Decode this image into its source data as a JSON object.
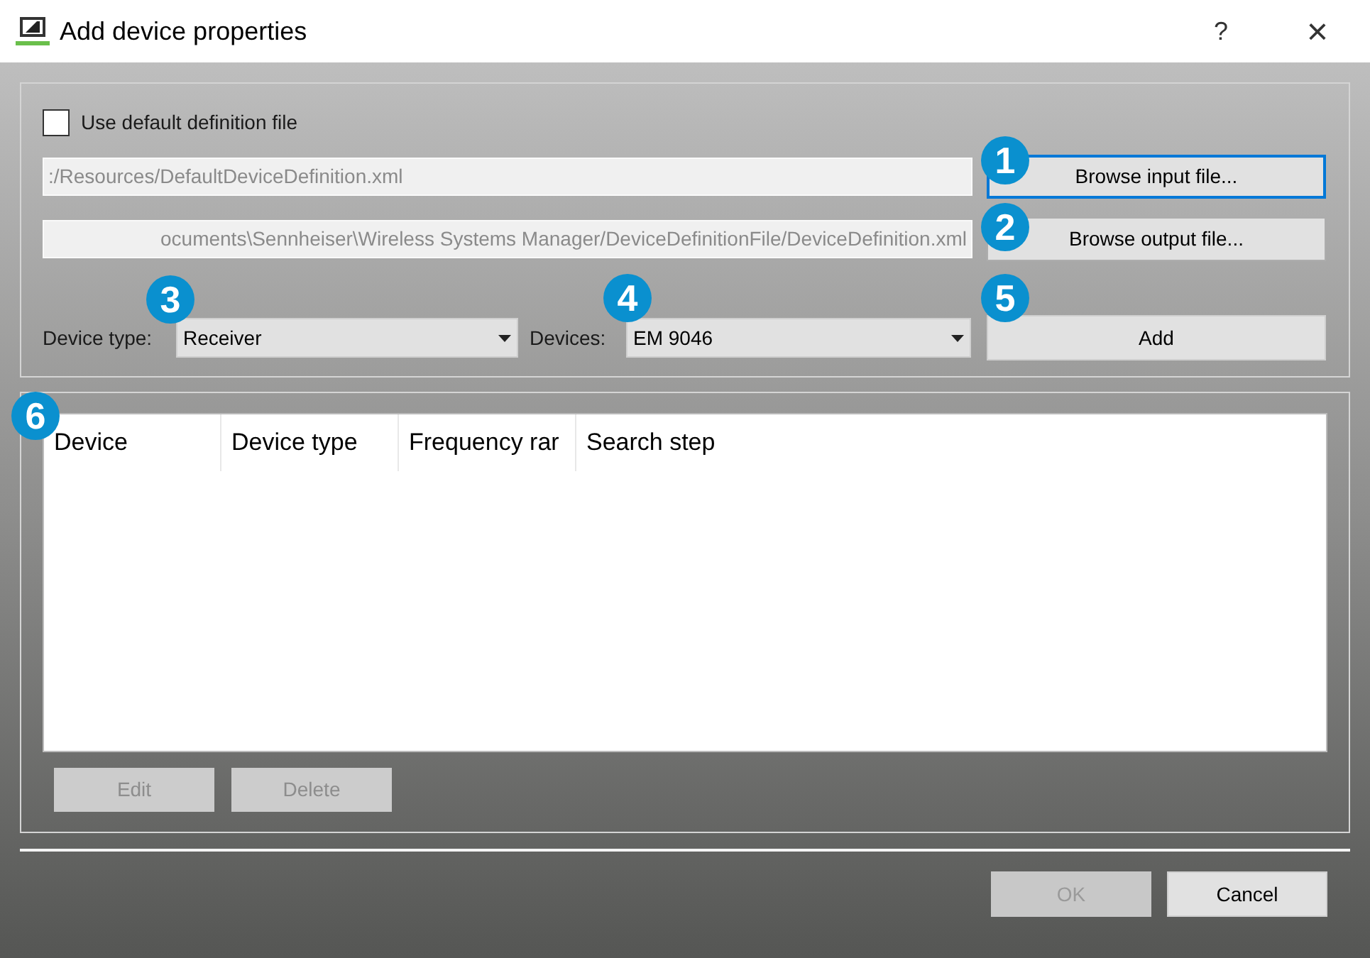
{
  "window": {
    "title": "Add device properties",
    "help": "?",
    "close": "×"
  },
  "use_default": {
    "label": "Use default definition file",
    "checked": false
  },
  "input_path": {
    "value": ":/Resources/DefaultDeviceDefinition.xml",
    "disabled": true
  },
  "output_path": {
    "value": "ocuments\\Sennheiser\\Wireless Systems Manager/DeviceDefinitionFile/DeviceDefinition.xml",
    "disabled": true
  },
  "browse_input": {
    "label": "Browse input file...",
    "focused": true
  },
  "browse_output": {
    "label": "Browse output file...",
    "focused": false
  },
  "device_type": {
    "label": "Device type:",
    "value": "Receiver"
  },
  "devices": {
    "label": "Devices:",
    "value": "EM 9046"
  },
  "add_button": {
    "label": "Add",
    "focused": false
  },
  "table": {
    "columns": [
      "Device",
      "Device type",
      "Frequency rar",
      "Search step"
    ]
  },
  "table_buttons": [
    {
      "label": "Edit",
      "disabled": true
    },
    {
      "label": "Delete",
      "disabled": true
    }
  ],
  "dialog_buttons": [
    {
      "label": "OK",
      "disabled": true
    },
    {
      "label": "Cancel",
      "disabled": false
    }
  ],
  "callouts": [
    {
      "label": "1"
    },
    {
      "label": "2"
    },
    {
      "label": "3"
    },
    {
      "label": "4"
    },
    {
      "label": "5"
    },
    {
      "label": "6"
    }
  ]
}
